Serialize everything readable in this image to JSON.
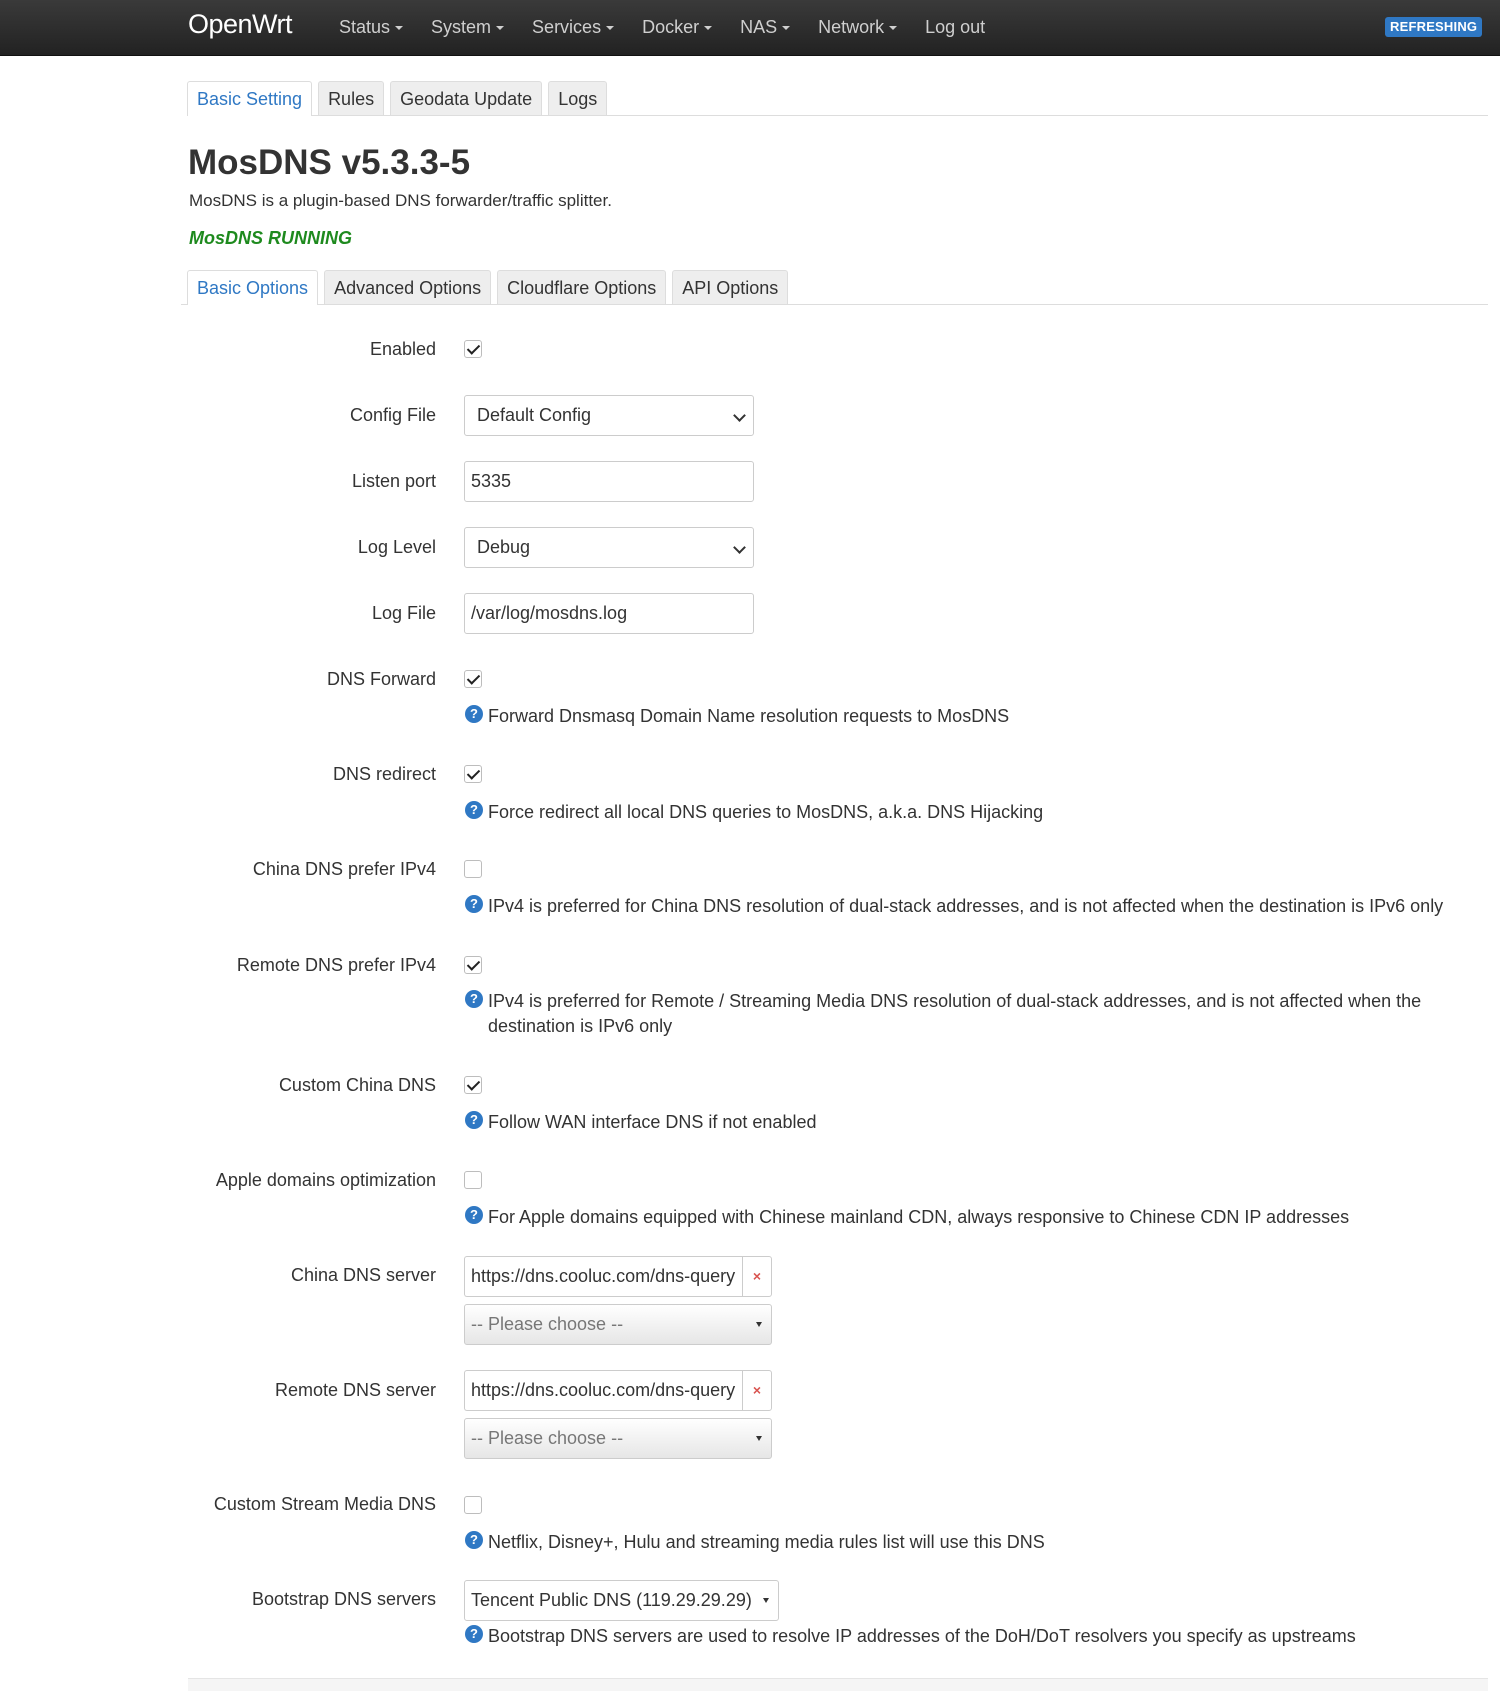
{
  "navbar": {
    "brand": "OpenWrt",
    "menu": [
      "Status",
      "System",
      "Services",
      "Docker",
      "NAS",
      "Network"
    ],
    "logout": "Log out",
    "badge": "REFRESHING"
  },
  "top_tabs": [
    "Basic Setting",
    "Rules",
    "Geodata Update",
    "Logs"
  ],
  "page": {
    "title": "MosDNS v5.3.3-5",
    "description": "MosDNS is a plugin-based DNS forwarder/traffic splitter.",
    "status": "MosDNS RUNNING"
  },
  "sub_tabs": [
    "Basic Options",
    "Advanced Options",
    "Cloudflare Options",
    "API Options"
  ],
  "form": {
    "enabled": {
      "label": "Enabled",
      "checked": true
    },
    "config_file": {
      "label": "Config File",
      "value": "Default Config"
    },
    "listen_port": {
      "label": "Listen port",
      "value": "5335"
    },
    "log_level": {
      "label": "Log Level",
      "value": "Debug"
    },
    "log_file": {
      "label": "Log File",
      "value": "/var/log/mosdns.log"
    },
    "dns_forward": {
      "label": "DNS Forward",
      "checked": true,
      "help": "Forward Dnsmasq Domain Name resolution requests to MosDNS"
    },
    "dns_redirect": {
      "label": "DNS redirect",
      "checked": true,
      "help": "Force redirect all local DNS queries to MosDNS, a.k.a. DNS Hijacking"
    },
    "china_ipv4": {
      "label": "China DNS prefer IPv4",
      "checked": false,
      "help": "IPv4 is preferred for China DNS resolution of dual-stack addresses, and is not affected when the destination is IPv6 only"
    },
    "remote_ipv4": {
      "label": "Remote DNS prefer IPv4",
      "checked": true,
      "help": "IPv4 is preferred for Remote / Streaming Media DNS resolution of dual-stack addresses, and is not affected when the destination is IPv6 only"
    },
    "custom_china_dns": {
      "label": "Custom China DNS",
      "checked": true,
      "help": "Follow WAN interface DNS if not enabled"
    },
    "apple_opt": {
      "label": "Apple domains optimization",
      "checked": false,
      "help": "For Apple domains equipped with Chinese mainland CDN, always responsive to Chinese CDN IP addresses"
    },
    "china_dns_server": {
      "label": "China DNS server",
      "value": "https://dns.cooluc.com/dns-query",
      "remove": "×",
      "choose": "-- Please choose --"
    },
    "remote_dns_server": {
      "label": "Remote DNS server",
      "value": "https://dns.cooluc.com/dns-query",
      "remove": "×",
      "choose": "-- Please choose --"
    },
    "stream_dns": {
      "label": "Custom Stream Media DNS",
      "checked": false,
      "help": "Netflix, Disney+, Hulu and streaming media rules list will use this DNS"
    },
    "bootstrap": {
      "label": "Bootstrap DNS servers",
      "value": "Tencent Public DNS (119.29.29.29)",
      "help": "Bootstrap DNS servers are used to resolve IP addresses of the DoH/DoT resolvers you specify as upstreams"
    }
  },
  "icons": {
    "help": "?"
  },
  "colors": {
    "accent": "#2f78c4",
    "running": "#1e8a1e",
    "remove": "#d9534f"
  }
}
